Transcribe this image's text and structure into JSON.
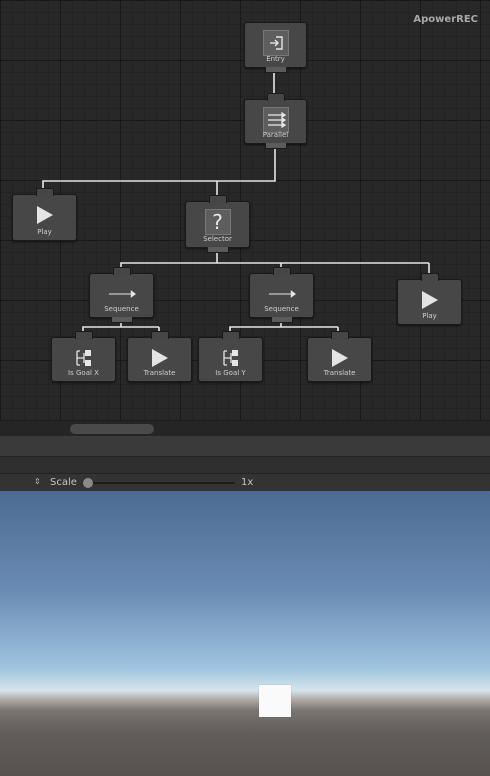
{
  "watermark": "ApowerREC",
  "nodes": {
    "entry": "Entry",
    "parallel": "Parallel",
    "play_left": "Play",
    "selector": "Selector",
    "sequence_1": "Sequence",
    "sequence_2": "Sequence",
    "play_right": "Play",
    "is_goal_x": "Is Goal X",
    "translate_1": "Translate",
    "is_goal_y": "Is Goal Y",
    "translate_2": "Translate"
  },
  "icons": {
    "entry": "enter-icon",
    "parallel": "parallel-arrows-icon",
    "play": "play-icon",
    "selector": "question-mark-icon",
    "sequence": "arrow-right-icon",
    "conditional": "conditional-branch-icon"
  },
  "selector_glyph": "?",
  "toolbar": {
    "scale_label": "Scale",
    "scale_value": "1x",
    "stepper_glyph": "⇕"
  },
  "colors": {
    "node_bg": "#474747",
    "wire": "#e6e6e6",
    "cube": "#fafafa"
  }
}
